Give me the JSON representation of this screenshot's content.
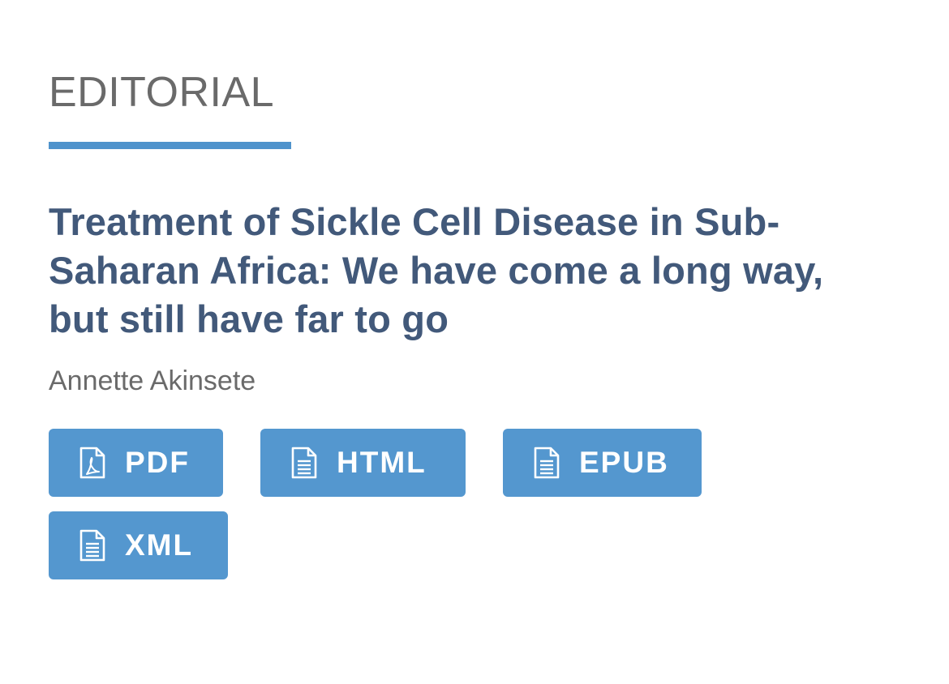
{
  "section": {
    "label": "EDITORIAL",
    "accent_color": "#4f93cc"
  },
  "article": {
    "title": "Treatment of Sickle Cell Disease in Sub-Saharan Africa: We have come a long way, but still have far to go",
    "author": "Annette Akinsete"
  },
  "colors": {
    "title": "#42597a",
    "button_bg": "#5497cf",
    "button_text": "#ffffff",
    "muted_text": "#6a6a6a"
  },
  "formats": {
    "pdf": {
      "label": "PDF",
      "icon": "pdf-file-icon"
    },
    "html": {
      "label": "HTML",
      "icon": "document-icon"
    },
    "epub": {
      "label": "EPUB",
      "icon": "document-icon"
    },
    "xml": {
      "label": "XML",
      "icon": "document-icon"
    }
  }
}
